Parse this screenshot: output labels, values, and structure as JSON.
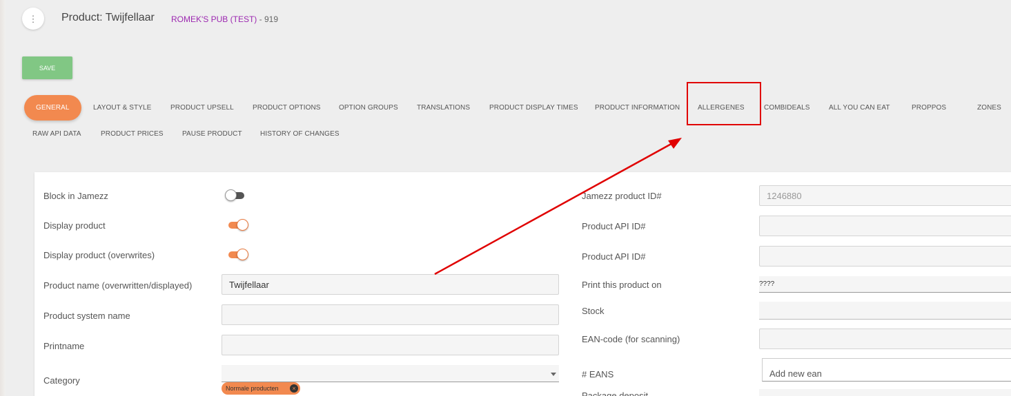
{
  "header": {
    "menu_icon": "⋮",
    "title": "Product: Twijfellaar",
    "venue": "ROMEK'S PUB (TEST)",
    "venue_suffix": " - 919"
  },
  "toolbar": {
    "save_label": "SAVE"
  },
  "tabs": [
    "GENERAL",
    "LAYOUT & STYLE",
    "PRODUCT UPSELL",
    "PRODUCT OPTIONS",
    "OPTION GROUPS",
    "TRANSLATIONS",
    "PRODUCT DISPLAY TIMES",
    "PRODUCT INFORMATION",
    "ALLERGENES",
    "COMBIDEALS",
    "ALL YOU CAN EAT",
    "PROPPOS",
    "ZONES",
    "RAW API DATA",
    "PRODUCT PRICES",
    "PAUSE PRODUCT",
    "HISTORY OF CHANGES"
  ],
  "active_tab": "GENERAL",
  "annotation": {
    "color": "#e00000",
    "target_tab": "ALLERGENES"
  },
  "left_form": {
    "block_label": "Block in Jamezz",
    "block_on": false,
    "display_label": "Display product",
    "display_on": true,
    "display_overwrites_label": "Display product (overwrites)",
    "display_overwrites_on": true,
    "name_label": "Product name (overwritten/displayed)",
    "name_value": "Twijfellaar",
    "system_name_label": "Product system name",
    "system_name_value": "",
    "printname_label": "Printname",
    "printname_value": "",
    "category_label": "Category",
    "category_chip": "Normale producten"
  },
  "right_form": {
    "jamezz_id_label": "Jamezz product ID#",
    "jamezz_id_value": "1246880",
    "api_id_label_1": "Product API ID#",
    "api_id_value_1": "",
    "api_id_label_2": "Product API ID#",
    "api_id_value_2": "",
    "print_label": "Print this product on",
    "print_value": "????",
    "stock_label": "Stock",
    "ean_label": "EAN-code (for scanning)",
    "ean_value": "",
    "eans_label": "# EANS",
    "eans_placeholder": "Add new ean",
    "deposit_label": "Package deposit"
  },
  "colors": {
    "accent": "#f2894f",
    "save": "#81c784",
    "venue": "#9c27b0",
    "annotation": "#e00000"
  }
}
